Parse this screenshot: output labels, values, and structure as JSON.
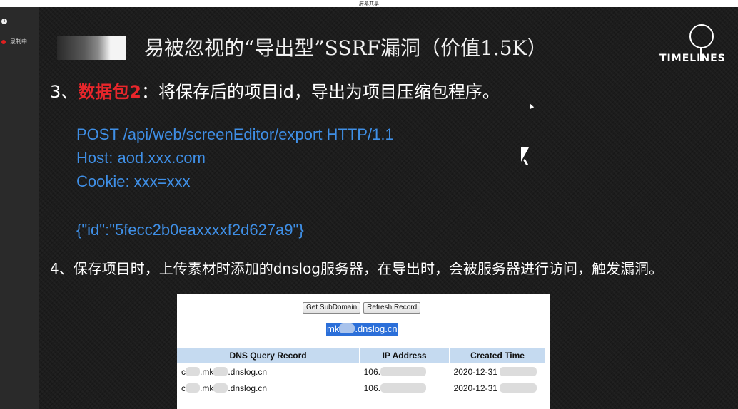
{
  "window": {
    "title": "屏幕共享"
  },
  "recorder": {
    "label": "录制中"
  },
  "slide": {
    "title": "易被忽视的“导出型”SSRF漏洞（价值1.5K）",
    "logo_text": "TIMELINES",
    "step3": {
      "prefix": "3、",
      "highlight": "数据包2",
      "rest": "：将保存后的项目id，导出为项目压缩包程序。"
    },
    "request_lines": [
      "POST /api/web/screenEditor/export HTTP/1.1",
      "Host: aod.xxx.com",
      "Cookie: xxx=xxx"
    ],
    "json_body": "{\"id\":\"5fecc2b0eaxxxxf2d627a9\"}",
    "step4": "4、保存项目时，上传素材时添加的dnslog服务器，在导出时，会被服务器进行访问，触发漏洞。"
  },
  "dnslog": {
    "buttons": {
      "get_subdomain": "Get SubDomain",
      "refresh_record": "Refresh Record"
    },
    "subdomain": {
      "prefix": "mk",
      "suffix": ".dnslog.cn"
    },
    "headers": [
      "DNS Query Record",
      "IP Address",
      "Created Time"
    ],
    "rows": [
      {
        "query_prefix": "c",
        "query_mid": ".mk",
        "query_suffix": ".dnslog.cn",
        "ip": "106.",
        "time": "2020-12-31"
      },
      {
        "query_prefix": "c",
        "query_mid": ".mk",
        "query_suffix": ".dnslog.cn",
        "ip": "106.",
        "time": "2020-12-31"
      }
    ]
  }
}
